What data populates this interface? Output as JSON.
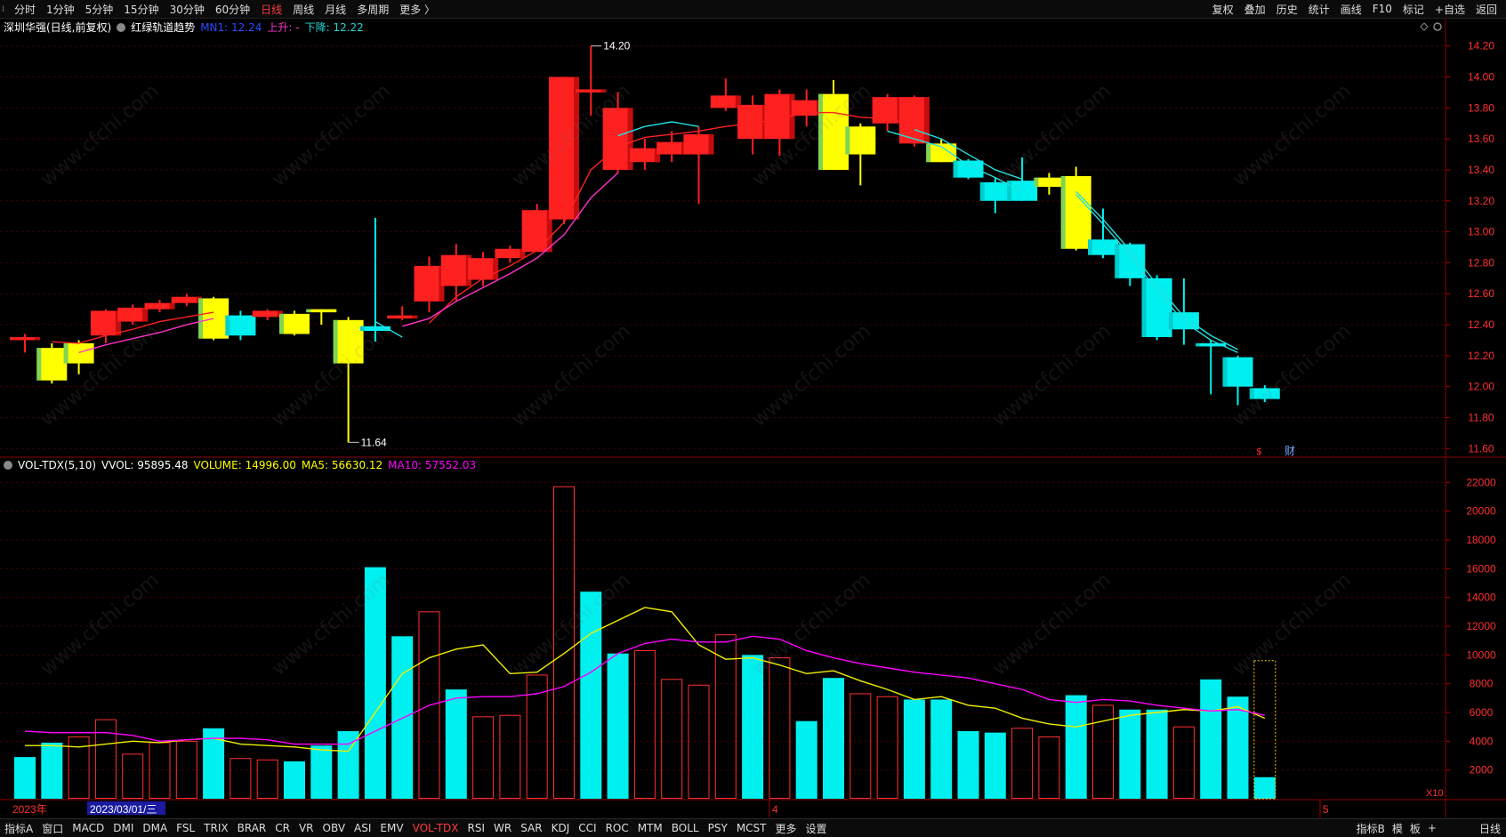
{
  "toolbar": {
    "periods": [
      "分时",
      "1分钟",
      "5分钟",
      "15分钟",
      "30分钟",
      "60分钟",
      "日线",
      "周线",
      "月线",
      "多周期",
      "更多 〉"
    ],
    "active_period": "日线",
    "right_items": [
      "复权",
      "叠加",
      "历史",
      "统计",
      "画线",
      "F10",
      "标记",
      "+自选",
      "返回"
    ]
  },
  "price_panel": {
    "stock_label": "深圳华强(日线,前复权)",
    "indicator_name": "红绿轨道趋势",
    "mn1_label": "MN1: 12.24",
    "up_label": "上升: -",
    "down_label": "下降: 12.22",
    "high_marker": "14.20",
    "low_marker": "11.64",
    "event_markers": [
      "$",
      "财"
    ],
    "price_ticks": [
      "14.20",
      "14.00",
      "13.80",
      "13.60",
      "13.40",
      "13.20",
      "13.00",
      "12.80",
      "12.60",
      "12.40",
      "12.20",
      "12.00",
      "11.80",
      "11.60"
    ]
  },
  "volume_panel": {
    "title": "VOL-TDX(5,10)",
    "vvol": "VVOL: 95895.48",
    "volume": "VOLUME: 14996.00",
    "ma5": "MA5: 56630.12",
    "ma10": "MA10: 57552.03",
    "vol_ticks": [
      "22000",
      "20000",
      "18000",
      "16000",
      "14000",
      "12000",
      "10000",
      "8000",
      "6000",
      "4000",
      "2000"
    ],
    "unit_label": "X10"
  },
  "time_axis": {
    "year_label": "2023年",
    "cursor_date": "2023/03/01/三",
    "month_4": "4",
    "month_5": "5",
    "period_label": "日线"
  },
  "bottom_tabs": [
    "指标A",
    "窗口",
    "MACD",
    "DMI",
    "DMA",
    "FSL",
    "TRIX",
    "BRAR",
    "CR",
    "VR",
    "OBV",
    "ASI",
    "EMV",
    "VOL-TDX",
    "RSI",
    "WR",
    "SAR",
    "KDJ",
    "CCI",
    "ROC",
    "MTM",
    "BOLL",
    "PSY",
    "MCST",
    "更多",
    "设置"
  ],
  "active_tab": "VOL-TDX",
  "bottom_right": [
    "指标B",
    "模",
    "板",
    "+"
  ],
  "watermark": "www.cfchi.com",
  "colors": {
    "up": "#ff2020",
    "down": "#00f0f0",
    "yellow": "#ffff00",
    "ma5": "#f0f000",
    "ma10": "#ff00ff",
    "grid": "#3a0000"
  },
  "chart_data": {
    "type": "candlestick",
    "candles": [
      {
        "o": 12.32,
        "c": 12.3,
        "h": 12.34,
        "l": 12.22,
        "k": "red"
      },
      {
        "o": 12.04,
        "c": 12.25,
        "h": 12.28,
        "l": 12.02,
        "k": "yellow"
      },
      {
        "o": 12.15,
        "c": 12.28,
        "h": 12.3,
        "l": 12.08,
        "k": "yellow"
      },
      {
        "o": 12.33,
        "c": 12.49,
        "h": 12.5,
        "l": 12.28,
        "k": "red"
      },
      {
        "o": 12.42,
        "c": 12.51,
        "h": 12.53,
        "l": 12.4,
        "k": "red"
      },
      {
        "o": 12.5,
        "c": 12.54,
        "h": 12.56,
        "l": 12.48,
        "k": "red"
      },
      {
        "o": 12.54,
        "c": 12.58,
        "h": 12.6,
        "l": 12.52,
        "k": "red"
      },
      {
        "o": 12.31,
        "c": 12.57,
        "h": 12.58,
        "l": 12.3,
        "k": "yellow"
      },
      {
        "o": 12.46,
        "c": 12.33,
        "h": 12.49,
        "l": 12.3,
        "k": "cyan"
      },
      {
        "o": 12.45,
        "c": 12.49,
        "h": 12.5,
        "l": 12.43,
        "k": "red"
      },
      {
        "o": 12.34,
        "c": 12.47,
        "h": 12.49,
        "l": 12.33,
        "k": "yellow"
      },
      {
        "o": 12.48,
        "c": 12.5,
        "h": 12.5,
        "l": 12.4,
        "k": "yellow"
      },
      {
        "o": 12.15,
        "c": 12.43,
        "h": 12.45,
        "l": 11.64,
        "k": "yellow"
      },
      {
        "o": 12.39,
        "c": 12.36,
        "h": 13.09,
        "l": 12.29,
        "k": "cyan"
      },
      {
        "o": 12.44,
        "c": 12.46,
        "h": 12.52,
        "l": 12.43,
        "k": "red"
      },
      {
        "o": 12.55,
        "c": 12.78,
        "h": 12.84,
        "l": 12.48,
        "k": "red"
      },
      {
        "o": 12.65,
        "c": 12.85,
        "h": 12.92,
        "l": 12.55,
        "k": "red"
      },
      {
        "o": 12.69,
        "c": 12.83,
        "h": 12.87,
        "l": 12.65,
        "k": "red"
      },
      {
        "o": 12.83,
        "c": 12.89,
        "h": 12.91,
        "l": 12.8,
        "k": "red"
      },
      {
        "o": 12.87,
        "c": 13.14,
        "h": 13.18,
        "l": 12.87,
        "k": "red"
      },
      {
        "o": 13.08,
        "c": 14.0,
        "h": 14.0,
        "l": 13.05,
        "k": "red"
      },
      {
        "o": 13.9,
        "c": 13.92,
        "h": 14.2,
        "l": 13.75,
        "k": "red"
      },
      {
        "o": 13.4,
        "c": 13.8,
        "h": 13.9,
        "l": 13.38,
        "k": "red"
      },
      {
        "o": 13.45,
        "c": 13.54,
        "h": 13.6,
        "l": 13.4,
        "k": "red"
      },
      {
        "o": 13.5,
        "c": 13.58,
        "h": 13.65,
        "l": 13.45,
        "k": "red"
      },
      {
        "o": 13.5,
        "c": 13.63,
        "h": 13.68,
        "l": 13.18,
        "k": "red"
      },
      {
        "o": 13.8,
        "c": 13.88,
        "h": 13.99,
        "l": 13.78,
        "k": "red"
      },
      {
        "o": 13.6,
        "c": 13.82,
        "h": 13.88,
        "l": 13.5,
        "k": "red"
      },
      {
        "o": 13.6,
        "c": 13.89,
        "h": 13.92,
        "l": 13.49,
        "k": "red"
      },
      {
        "o": 13.75,
        "c": 13.85,
        "h": 13.92,
        "l": 13.68,
        "k": "red"
      },
      {
        "o": 13.4,
        "c": 13.89,
        "h": 13.98,
        "l": 13.4,
        "k": "yellow"
      },
      {
        "o": 13.5,
        "c": 13.68,
        "h": 13.7,
        "l": 13.3,
        "k": "yellow"
      },
      {
        "o": 13.7,
        "c": 13.87,
        "h": 13.89,
        "l": 13.65,
        "k": "red"
      },
      {
        "o": 13.57,
        "c": 13.87,
        "h": 13.88,
        "l": 13.55,
        "k": "red"
      },
      {
        "o": 13.45,
        "c": 13.57,
        "h": 13.6,
        "l": 13.45,
        "k": "yellow"
      },
      {
        "o": 13.46,
        "c": 13.35,
        "h": 13.47,
        "l": 13.34,
        "k": "cyan"
      },
      {
        "o": 13.32,
        "c": 13.2,
        "h": 13.35,
        "l": 13.12,
        "k": "cyan"
      },
      {
        "o": 13.33,
        "c": 13.2,
        "h": 13.48,
        "l": 13.2,
        "k": "cyan"
      },
      {
        "o": 13.29,
        "c": 13.35,
        "h": 13.38,
        "l": 13.24,
        "k": "yellow"
      },
      {
        "o": 12.89,
        "c": 13.36,
        "h": 13.42,
        "l": 12.88,
        "k": "yellow"
      },
      {
        "o": 12.95,
        "c": 12.85,
        "h": 13.15,
        "l": 12.83,
        "k": "cyan"
      },
      {
        "o": 12.92,
        "c": 12.7,
        "h": 12.93,
        "l": 12.65,
        "k": "cyan"
      },
      {
        "o": 12.7,
        "c": 12.32,
        "h": 12.72,
        "l": 12.3,
        "k": "cyan"
      },
      {
        "o": 12.48,
        "c": 12.37,
        "h": 12.7,
        "l": 12.27,
        "k": "cyan"
      },
      {
        "o": 12.28,
        "c": 12.26,
        "h": 12.3,
        "l": 11.95,
        "k": "cyan"
      },
      {
        "o": 12.19,
        "c": 12.0,
        "h": 12.2,
        "l": 11.88,
        "k": "cyan"
      },
      {
        "o": 11.99,
        "c": 11.92,
        "h": 12.01,
        "l": 11.9,
        "k": "cyan"
      }
    ],
    "volumes": [
      2900,
      3900,
      4300,
      5500,
      3100,
      3900,
      4000,
      4900,
      2800,
      2700,
      2600,
      3700,
      4700,
      16100,
      11300,
      13000,
      7600,
      5700,
      5800,
      8600,
      21700,
      14400,
      10100,
      10300,
      8300,
      7900,
      11400,
      10000,
      9800,
      5400,
      8400,
      7300,
      7100,
      6900,
      6900,
      4700,
      4600,
      4900,
      4300,
      7200,
      6500,
      6200,
      6200,
      5000,
      8300,
      7100,
      1500
    ],
    "vol_kind": [
      "c",
      "c",
      "r",
      "r",
      "r",
      "r",
      "r",
      "c",
      "r",
      "r",
      "c",
      "c",
      "c",
      "c",
      "c",
      "r",
      "c",
      "r",
      "r",
      "r",
      "r",
      "c",
      "c",
      "r",
      "r",
      "r",
      "r",
      "c",
      "r",
      "c",
      "c",
      "r",
      "r",
      "c",
      "c",
      "c",
      "c",
      "r",
      "r",
      "c",
      "r",
      "c",
      "c",
      "r",
      "c",
      "c",
      "c"
    ],
    "ma5": [
      3700,
      3700,
      3600,
      3800,
      4000,
      3900,
      4100,
      4200,
      3800,
      3700,
      3600,
      3400,
      3300,
      6000,
      8700,
      9800,
      10400,
      10700,
      8700,
      8800,
      10100,
      11500,
      12400,
      13300,
      13000,
      10700,
      9700,
      9800,
      9300,
      8700,
      8900,
      8200,
      7600,
      6900,
      7100,
      6500,
      6300,
      5600,
      5200,
      5000,
      5400,
      5800,
      6000,
      6200,
      6100,
      6400,
      5600
    ],
    "ma10": [
      4700,
      4600,
      4600,
      4600,
      4400,
      4000,
      4100,
      4200,
      4200,
      4100,
      3800,
      3800,
      3800,
      4700,
      5600,
      6500,
      7000,
      7100,
      7100,
      7300,
      7800,
      8800,
      10100,
      10800,
      11100,
      10900,
      10900,
      11300,
      11100,
      10300,
      9800,
      9400,
      9100,
      8800,
      8600,
      8400,
      8000,
      7600,
      6900,
      6700,
      6900,
      6800,
      6500,
      6300,
      6100,
      6200,
      5800
    ],
    "trend_red": [
      null,
      12.29,
      12.28,
      12.33,
      12.37,
      12.42,
      12.45,
      12.48,
      null,
      null,
      null,
      null,
      null,
      null,
      null,
      12.41,
      12.58,
      12.7,
      12.78,
      12.88,
      13.06,
      13.4,
      13.55,
      13.61,
      13.63,
      13.65,
      13.68,
      13.7,
      13.73,
      13.77,
      13.77,
      13.74,
      13.73,
      13.69,
      null,
      null,
      null,
      null,
      null,
      null,
      null,
      null,
      null,
      null,
      null,
      null,
      null
    ],
    "trend_magenta": [
      null,
      null,
      12.22,
      12.27,
      12.31,
      12.35,
      12.4,
      12.44,
      null,
      null,
      null,
      null,
      null,
      null,
      12.39,
      12.44,
      12.55,
      12.64,
      12.73,
      12.83,
      12.98,
      13.22,
      13.38,
      null,
      null,
      null,
      null,
      null,
      null,
      null,
      null,
      null,
      null,
      null,
      null,
      null,
      null,
      null,
      null,
      null,
      null,
      null,
      null,
      null,
      null,
      null,
      null
    ],
    "trend_cyan_a": [
      null,
      null,
      null,
      null,
      null,
      null,
      null,
      null,
      12.4,
      null,
      null,
      null,
      null,
      12.42,
      12.32,
      null,
      null,
      null,
      null,
      null,
      null,
      null,
      13.62,
      13.68,
      13.71,
      13.68,
      null,
      null,
      null,
      null,
      null,
      null,
      13.65,
      13.6,
      13.55,
      13.43,
      13.35,
      13.26,
      null,
      13.24,
      13.05,
      12.85,
      12.62,
      12.42,
      12.3,
      12.22,
      null
    ],
    "trend_cyan_b": [
      null,
      null,
      null,
      null,
      null,
      null,
      null,
      null,
      null,
      null,
      null,
      null,
      null,
      null,
      null,
      null,
      null,
      null,
      null,
      null,
      null,
      null,
      null,
      null,
      null,
      null,
      null,
      null,
      null,
      null,
      null,
      null,
      null,
      13.66,
      13.6,
      13.5,
      13.4,
      13.34,
      null,
      13.26,
      13.08,
      12.88,
      12.66,
      12.45,
      12.33,
      12.24,
      null
    ]
  }
}
